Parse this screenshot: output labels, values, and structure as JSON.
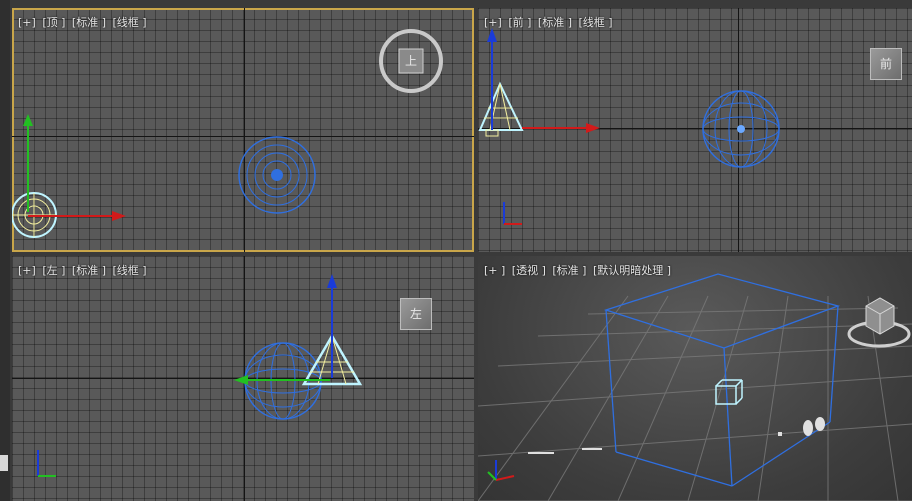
{
  "viewports": {
    "top": {
      "menu": "[+]",
      "view": "[顶 ]",
      "shading": "[标准 ]",
      "mode": "[线框 ]",
      "cube_face": "上"
    },
    "front": {
      "menu": "[+]",
      "view": "[前 ]",
      "shading": "[标准 ]",
      "mode": "[线框 ]",
      "cube_face": "前"
    },
    "left": {
      "menu": "[+]",
      "view": "[左 ]",
      "shading": "[标准 ]",
      "mode": "[线框 ]",
      "cube_face": "左"
    },
    "persp": {
      "menu": "[+ ]",
      "view": "[透视 ]",
      "shading": "[标准 ]",
      "mode": "[默认明暗处理 ]"
    }
  },
  "colors": {
    "active_border": "#c9a64a",
    "sphere": "#2f6fe0",
    "light": "#bff4ff",
    "axis_x": "#d21a1a",
    "axis_y": "#22c022",
    "axis_z": "#1a3bd8"
  }
}
